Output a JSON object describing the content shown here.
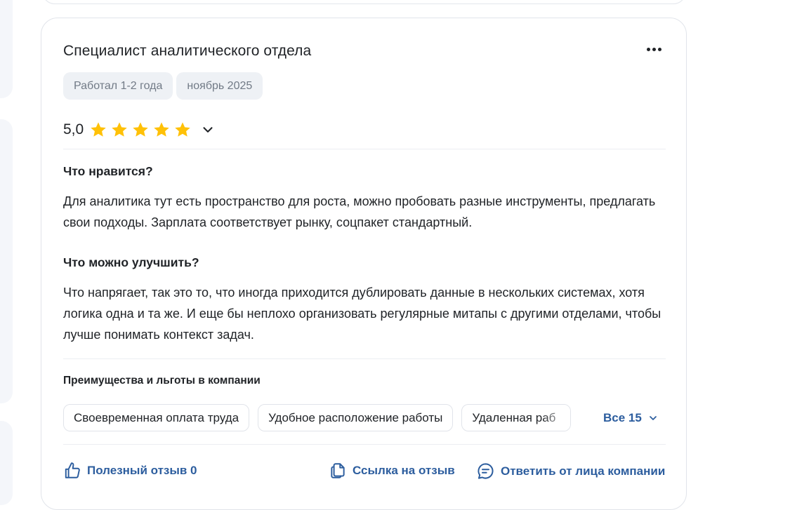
{
  "review": {
    "title": "Специалист аналитического отдела",
    "tags": [
      "Работал 1-2 года",
      "ноябрь 2025"
    ],
    "rating_text": "5,0",
    "rating_value": 5,
    "rating_max": 5,
    "likes_heading": "Что нравится?",
    "likes_text": "Для аналитика тут есть пространство для роста, можно пробовать разные инструменты, предлагать свои подходы. Зарплата соответствует рынку, соцпакет стандартный.",
    "improve_heading": "Что можно улучшить?",
    "improve_text": "Что напрягает, так это то, что иногда приходится дублировать данные в нескольких системах, хотя логика одна и та же. И еще бы неплохо организовать регулярные митапы с другими отделами, чтобы лучше понимать контекст задач.",
    "benefits_heading": "Преимущества и льготы в компании",
    "benefits": [
      "Своевременная оплата труда",
      "Удобное расположение работы",
      "Удаленная раб"
    ],
    "benefits_all": "Все 15",
    "actions": {
      "helpful": "Полезный отзыв 0",
      "link": "Ссылка на отзыв",
      "reply": "Ответить от лица компании"
    }
  },
  "colors": {
    "accent": "#2c5d9e",
    "star": "#ffc107",
    "chip_bg": "#eef1f5",
    "chip_text": "#717a86"
  },
  "icons": [
    "more-icon",
    "star-icon",
    "chevron-down-icon",
    "thumbs-up-icon",
    "copy-link-icon",
    "comment-icon"
  ]
}
